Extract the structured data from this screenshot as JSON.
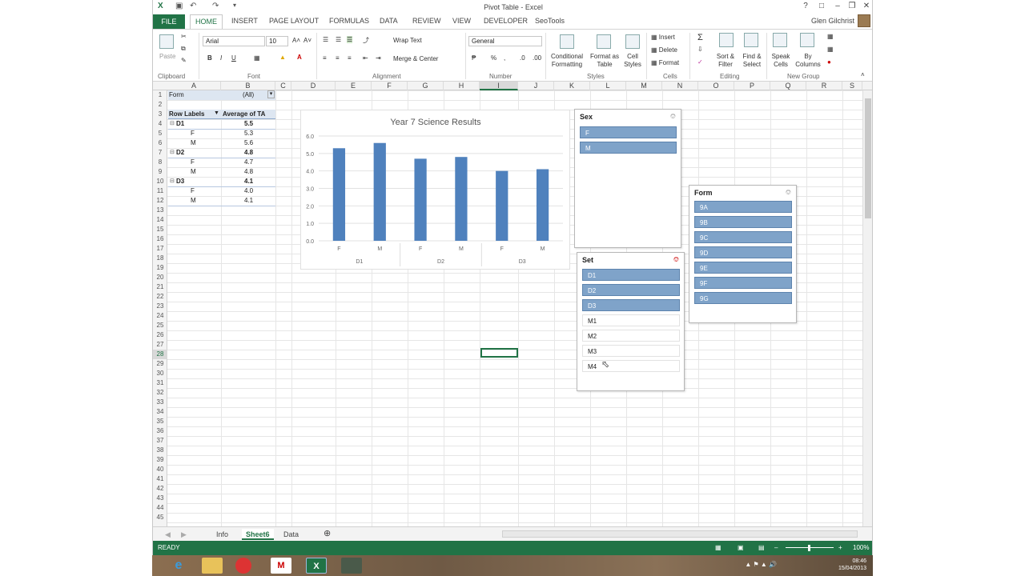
{
  "window": {
    "title": "Pivot Table - Excel",
    "user": "Glen Gilchrist"
  },
  "tabs": [
    "FILE",
    "HOME",
    "INSERT",
    "PAGE LAYOUT",
    "FORMULAS",
    "DATA",
    "REVIEW",
    "VIEW",
    "DEVELOPER",
    "SeoTools"
  ],
  "ribbon": {
    "font_name": "Arial",
    "font_size": "10",
    "wrap_text": "Wrap Text",
    "merge_center": "Merge & Center",
    "number_format": "General",
    "paste": "Paste",
    "conditional_formatting": "Conditional Formatting",
    "format_as_table": "Format as Table",
    "cell_styles": "Cell Styles",
    "insert": "Insert",
    "delete": "Delete",
    "format": "Format",
    "sort_filter": "Sort & Filter",
    "find_select": "Find & Select",
    "speak_cells": "Speak Cells",
    "by_columns": "By Columns",
    "groups": [
      "Clipboard",
      "Font",
      "Alignment",
      "Number",
      "Styles",
      "Cells",
      "Editing",
      "New Group"
    ]
  },
  "columns": [
    "A",
    "B",
    "C",
    "D",
    "E",
    "F",
    "G",
    "H",
    "I",
    "J",
    "K",
    "L",
    "M",
    "N",
    "O",
    "P",
    "Q",
    "R",
    "S"
  ],
  "rows": [
    "1",
    "2",
    "3",
    "4",
    "5",
    "6",
    "7",
    "8",
    "9",
    "10",
    "11",
    "12",
    "13",
    "14",
    "15",
    "16",
    "17",
    "18",
    "19",
    "20",
    "21",
    "22",
    "23",
    "24",
    "25",
    "26",
    "27",
    "28",
    "29",
    "30",
    "31",
    "32",
    "33",
    "34",
    "35",
    "36",
    "37",
    "38",
    "39",
    "40",
    "41",
    "42",
    "43",
    "44",
    "45"
  ],
  "pivot": {
    "filter_label": "Form",
    "filter_value": "(All)",
    "row_labels": "Row Labels",
    "value_header": "Average of TA",
    "rows": [
      {
        "label": "D1",
        "value": "5.5",
        "level": 0
      },
      {
        "label": "F",
        "value": "5.3",
        "level": 1
      },
      {
        "label": "M",
        "value": "5.6",
        "level": 1
      },
      {
        "label": "D2",
        "value": "4.8",
        "level": 0
      },
      {
        "label": "F",
        "value": "4.7",
        "level": 1
      },
      {
        "label": "M",
        "value": "4.8",
        "level": 1
      },
      {
        "label": "D3",
        "value": "4.1",
        "level": 0
      },
      {
        "label": "F",
        "value": "4.0",
        "level": 1
      },
      {
        "label": "M",
        "value": "4.1",
        "level": 1
      }
    ]
  },
  "chart_data": {
    "type": "bar",
    "title": "Year 7 Science Results",
    "categories": [
      "F",
      "M",
      "F",
      "M",
      "F",
      "M"
    ],
    "groups": [
      "D1",
      "D2",
      "D3"
    ],
    "values": [
      5.3,
      5.6,
      4.7,
      4.8,
      4.0,
      4.1
    ],
    "ylim": [
      0,
      6
    ],
    "yticks": [
      "0.0",
      "1.0",
      "2.0",
      "3.0",
      "4.0",
      "5.0",
      "6.0"
    ],
    "bar_color": "#4f81bd",
    "grid": true
  },
  "slicers": {
    "sex": {
      "title": "Sex",
      "items": [
        {
          "label": "F",
          "selected": true
        },
        {
          "label": "M",
          "selected": true
        }
      ]
    },
    "set": {
      "title": "Set",
      "items": [
        {
          "label": "D1",
          "selected": true
        },
        {
          "label": "D2",
          "selected": true
        },
        {
          "label": "D3",
          "selected": true
        },
        {
          "label": "M1",
          "selected": false
        },
        {
          "label": "M2",
          "selected": false
        },
        {
          "label": "M3",
          "selected": false
        },
        {
          "label": "M4",
          "selected": false
        }
      ]
    },
    "form": {
      "title": "Form",
      "items": [
        {
          "label": "9A",
          "selected": true
        },
        {
          "label": "9B",
          "selected": true
        },
        {
          "label": "9C",
          "selected": true
        },
        {
          "label": "9D",
          "selected": true
        },
        {
          "label": "9E",
          "selected": true
        },
        {
          "label": "9F",
          "selected": true
        },
        {
          "label": "9G",
          "selected": true
        }
      ]
    }
  },
  "sheets": {
    "tabs": [
      "Info",
      "Sheet6",
      "Data"
    ],
    "active": "Sheet6"
  },
  "status": {
    "mode": "READY",
    "zoom": "100%"
  },
  "taskbar": {
    "time": "08:46",
    "date": "15/04/2013"
  },
  "colors": {
    "excel_green": "#217346",
    "slicer_selected": "#7fa3c9"
  }
}
